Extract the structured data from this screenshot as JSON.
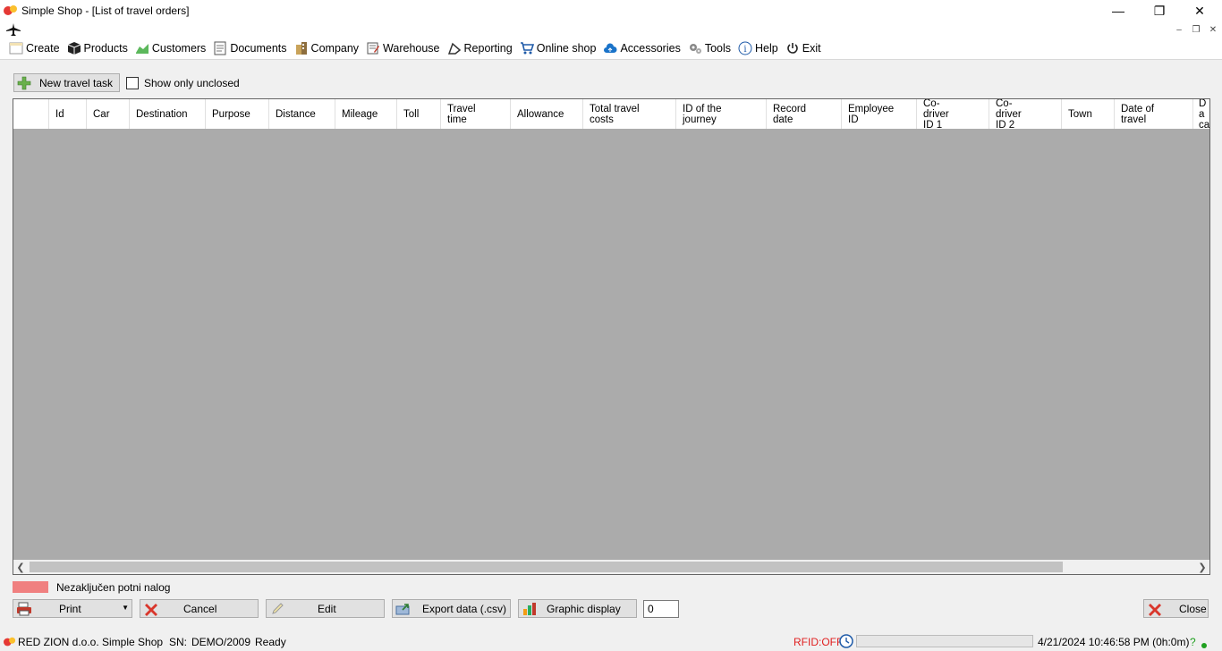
{
  "window": {
    "title": "Simple Shop - [List of travel orders]"
  },
  "menu": [
    {
      "label": "Create",
      "icon": "create-icon"
    },
    {
      "label": "Products",
      "icon": "box-icon"
    },
    {
      "label": "Customers",
      "icon": "customers-icon"
    },
    {
      "label": "Documents",
      "icon": "document-icon"
    },
    {
      "label": "Company",
      "icon": "building-icon"
    },
    {
      "label": "Warehouse",
      "icon": "warehouse-icon"
    },
    {
      "label": "Reporting",
      "icon": "reporting-icon"
    },
    {
      "label": "Online shop",
      "icon": "cart-icon"
    },
    {
      "label": "Accessories",
      "icon": "cloud-icon"
    },
    {
      "label": "Tools",
      "icon": "gears-icon"
    },
    {
      "label": "Help",
      "icon": "info-icon"
    },
    {
      "label": "Exit",
      "icon": "power-icon"
    }
  ],
  "toolbar": {
    "new_travel_task": "New travel task",
    "show_only_unclosed": "Show only unclosed"
  },
  "grid": {
    "columns": [
      "",
      "Id",
      "Car",
      "Destination",
      "Purpose",
      "Distance",
      "Mileage",
      "Toll",
      "Travel time",
      "Allowance",
      "Total travel costs",
      "ID of the journey",
      "Record date",
      "Employee ID",
      "Co-driver ID 1",
      "Co-driver ID 2",
      "Town",
      "Date of travel",
      "Da ca"
    ],
    "rows": []
  },
  "legend": {
    "text": "Nezaključen potni nalog",
    "color": "#f08080"
  },
  "actions": {
    "print": "Print",
    "cancel": "Cancel",
    "edit": "Edit",
    "export": "Export data (.csv)",
    "graphic": "Graphic display",
    "count": "0",
    "close": "Close"
  },
  "status": {
    "company": "RED ZION d.o.o.",
    "app": "Simple Shop",
    "sn_label": "SN:",
    "sn_value": "DEMO/2009",
    "state": "Ready",
    "rfid": "RFID:OFF",
    "datetime": "4/21/2024 10:46:58 PM (0h:0m)",
    "help": "?",
    "progress_pct": 0
  },
  "colors": {
    "rfid": "#e02020",
    "online_dot": "#20a020",
    "grid_bg": "#ababab"
  }
}
